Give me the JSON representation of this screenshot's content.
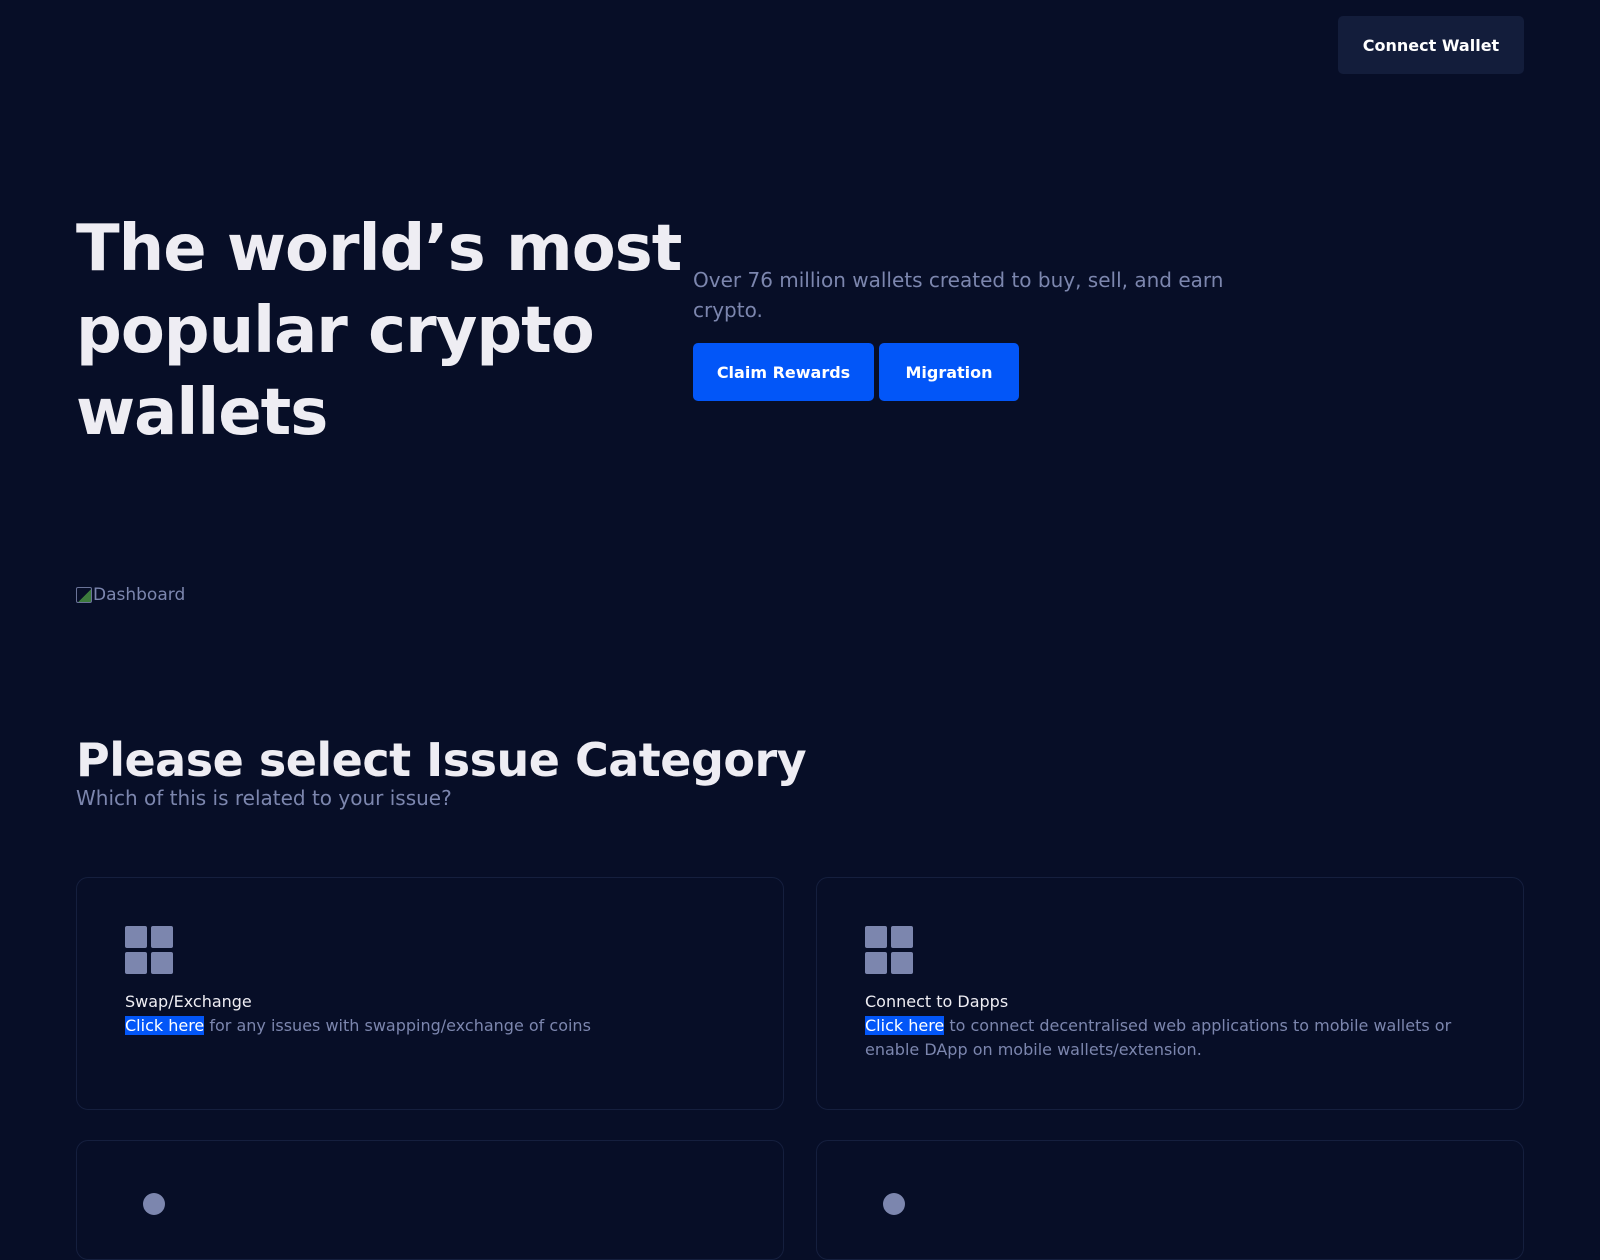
{
  "header": {
    "connect_wallet_label": "Connect Wallet"
  },
  "hero": {
    "title": "The world’s most popular crypto wallets",
    "subtitle": "Over 76 million wallets created to buy, sell, and earn crypto.",
    "claim_rewards_label": "Claim Rewards",
    "migration_label": "Migration"
  },
  "dashboard_image": {
    "alt": "Dashboard"
  },
  "issues": {
    "title": "Please select Issue Category",
    "subtitle": "Which of this is related to your issue?",
    "cards": [
      {
        "icon": "grid-icon",
        "title": "Swap/Exchange",
        "link_text": "Click here",
        "description": " for any issues with swapping/exchange of coins"
      },
      {
        "icon": "grid-icon",
        "title": "Connect to Dapps",
        "link_text": "Click here",
        "description": " to connect decentralised web applications to mobile wallets or enable DApp on mobile wallets/extension."
      },
      {
        "icon": "circle-icon"
      },
      {
        "icon": "circle-icon"
      }
    ]
  },
  "colors": {
    "background": "#070e27",
    "primary_button": "#0256f8",
    "secondary_button": "#131d3b",
    "muted_text": "#7c86ae",
    "heading_text": "#eeedf3"
  }
}
